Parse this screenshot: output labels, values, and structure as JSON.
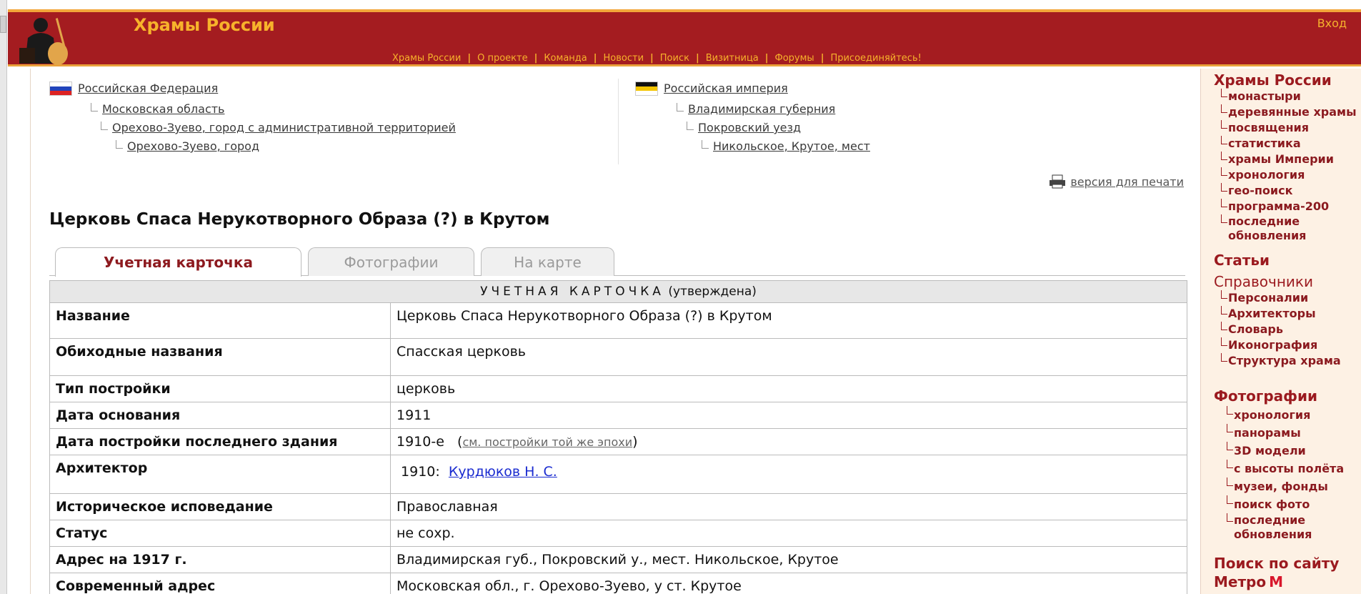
{
  "header": {
    "site_title": "Храмы России",
    "login": "Вход",
    "nav": [
      "Храмы России",
      "О проекте",
      "Команда",
      "Новости",
      "Поиск",
      "Визитница",
      "Форумы",
      "Присоединяйтесь!"
    ]
  },
  "locations": {
    "modern": {
      "country": "Российская Федерация",
      "region": "Московская область",
      "district": "Орехово-Зуево, город с административной территорией",
      "locality": "Орехово-Зуево, город"
    },
    "empire": {
      "country": "Российская империя",
      "region": "Владимирская губерния",
      "district": "Покровский уезд",
      "locality": "Никольское, Крутое, мест"
    }
  },
  "print_link": "версия для печати",
  "page_title": "Церковь Спаса Нерукотворного Образа (?) в Крутом",
  "tabs": [
    "Учетная карточка",
    "Фотографии",
    "На карте"
  ],
  "card": {
    "header_main": "УЧЕТНАЯ КАРТОЧКА",
    "header_status": "(утверждена)",
    "rows": [
      {
        "key": "Название",
        "value": "Церковь Спаса Нерукотворного Образа (?) в Крутом"
      },
      {
        "key": "Обиходные названия",
        "value": "Спасская церковь"
      },
      {
        "key": "Тип постройки",
        "value": "церковь"
      },
      {
        "key": "Дата основания",
        "value": "1911"
      },
      {
        "key": "Дата постройки последнего здания",
        "value": "1910-е",
        "link": "см. постройки той же эпохи"
      },
      {
        "key": "Архитектор",
        "year": "1910:",
        "value": "Курдюков Н. С."
      },
      {
        "key": "Историческое исповедание",
        "value": "Православная"
      },
      {
        "key": "Статус",
        "value": "не сохр."
      },
      {
        "key": "Адрес на 1917 г.",
        "value": "Владимирская губ., Покровский у., мест. Никольское, Крутое"
      },
      {
        "key": "Современный адрес",
        "value": "Московская обл., г. Орехово-Зуево, у ст. Крутое"
      }
    ]
  },
  "sidebar": {
    "section1_title": "Храмы России",
    "section1_items": [
      "монастыри",
      "деревянные храмы",
      "посвящения",
      "статистика",
      "храмы Империи",
      "хронология",
      "гео-поиск",
      "программа-200",
      "последние обновления"
    ],
    "section2_title": "Статьи",
    "section3_title": "Справочники",
    "section3_items": [
      "Персоналии",
      "Архитекторы",
      "Словарь",
      "Иконография",
      "Структура храма"
    ],
    "section4_title": "Фотографии",
    "section4_items": [
      "хронология",
      "панорамы",
      "3D модели",
      "с высоты полёта",
      "музеи, фонды",
      "поиск фото",
      "последние обновления"
    ],
    "search_title": "Поиск по сайту",
    "metro_title": "Метро",
    "metro_symbol": "М"
  }
}
